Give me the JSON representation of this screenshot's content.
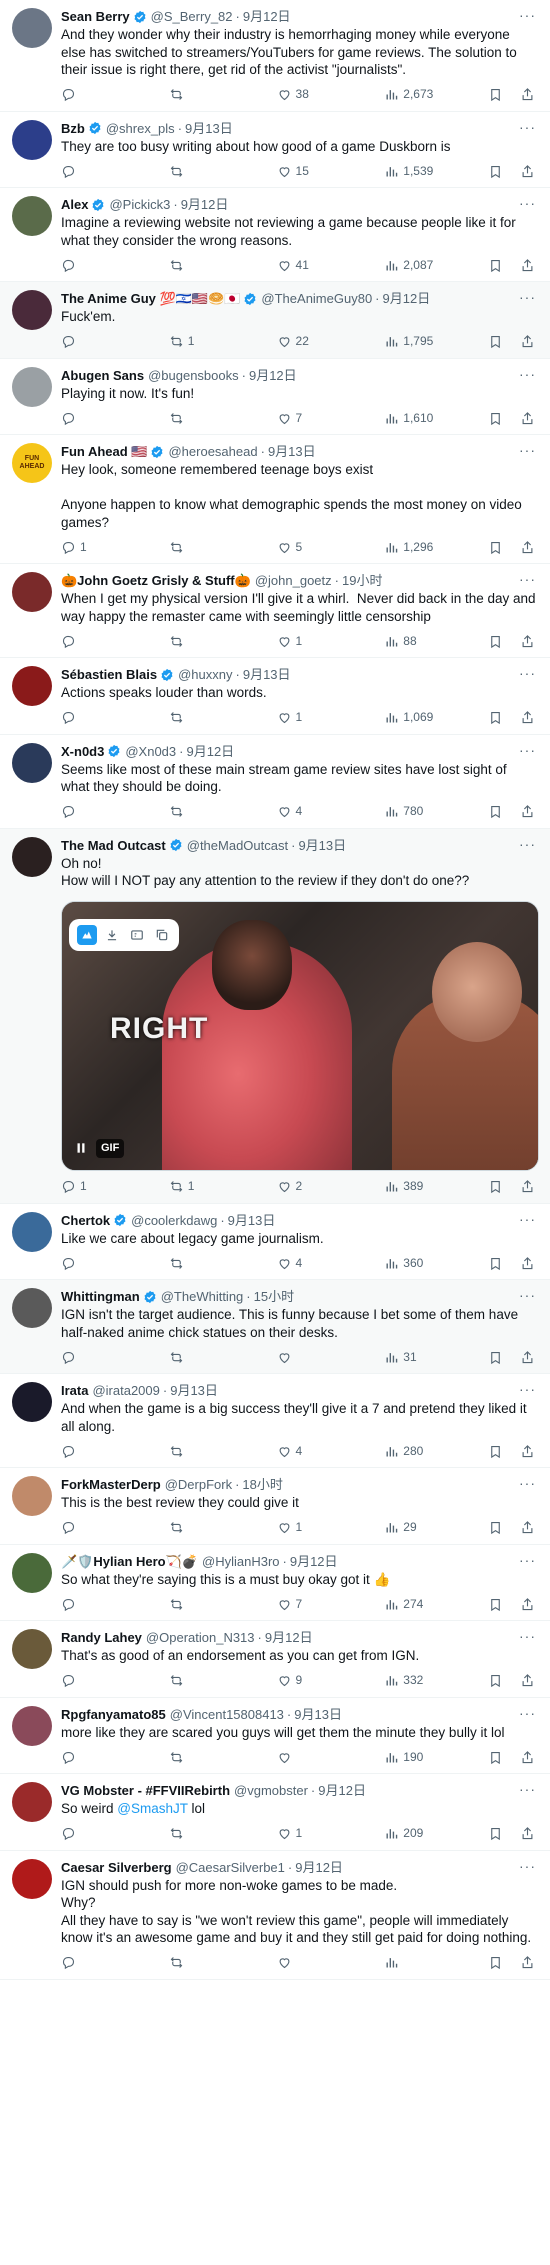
{
  "feed": {
    "tweets": [
      {
        "name": "Sean Berry",
        "badges": [
          "verified"
        ],
        "handle": "@S_Berry_82",
        "time": "9月12日",
        "text": "And they wonder why their industry is hemorrhaging money while everyone else has switched to streamers/YouTubers for game reviews. The solution to their issue is right there, get rid of the activist \"journalists\".",
        "replies": "",
        "reposts": "",
        "likes": "38",
        "views": "2,673",
        "avatar_color": "#6b7686"
      },
      {
        "name": "Bzb",
        "badges": [
          "verified"
        ],
        "handle": "@shrex_pls",
        "time": "9月13日",
        "text": "They are too busy writing about how good of a game Duskborn is",
        "replies": "",
        "reposts": "",
        "likes": "15",
        "views": "1,539",
        "avatar_color": "#2c3e8a"
      },
      {
        "name": "Alex",
        "badges": [
          "verified"
        ],
        "handle": "@Pickick3",
        "time": "9月12日",
        "text": "Imagine a reviewing website not reviewing a game because people like it for what they consider the wrong reasons.",
        "replies": "",
        "reposts": "",
        "likes": "41",
        "views": "2,087",
        "avatar_color": "#5a6b4a"
      },
      {
        "name": "The Anime Guy 💯🇮🇱🇺🇸🥯🇯🇵",
        "badges": [
          "verified"
        ],
        "handle": "@TheAnimeGuy80",
        "time": "9月12日",
        "text": "Fuck'em.",
        "replies": "",
        "reposts": "1",
        "likes": "22",
        "views": "1,795",
        "avatar_color": "#4a2a3a",
        "highlight": true
      },
      {
        "name": "Abugen Sans",
        "badges": [],
        "handle": "@bugensbooks",
        "time": "9月12日",
        "text": "Playing it now. It's fun!",
        "replies": "",
        "reposts": "",
        "likes": "7",
        "views": "1,610",
        "avatar_color": "#9aa0a4"
      },
      {
        "name": "Fun Ahead 🇺🇸",
        "badges": [
          "verified"
        ],
        "handle": "@heroesahead",
        "time": "9月13日",
        "text": "Hey look, someone remembered teenage boys exist\n\nAnyone happen to know what demographic spends the most money on video games?",
        "replies": "1",
        "reposts": "",
        "likes": "5",
        "views": "1,296",
        "avatar_color": "#f5c518",
        "avatar_label": "FUN AHEAD"
      },
      {
        "name": "🎃John Goetz Grisly & Stuff🎃",
        "badges": [],
        "handle": "@john_goetz",
        "time": "19小时",
        "text": "When I get my physical version I'll give it a whirl.  Never did back in the day and way happy the remaster came with seemingly little censorship",
        "replies": "",
        "reposts": "",
        "likes": "1",
        "views": "88",
        "avatar_color": "#7a2a2a"
      },
      {
        "name": "Sébastien Blais",
        "badges": [
          "verified"
        ],
        "handle": "@huxxny",
        "time": "9月13日",
        "text": "Actions speaks louder than words.",
        "replies": "",
        "reposts": "",
        "likes": "1",
        "views": "1,069",
        "avatar_color": "#8a1a1a"
      },
      {
        "name": "X-n0d3",
        "badges": [
          "verified"
        ],
        "handle": "@Xn0d3",
        "time": "9月12日",
        "text": "Seems like most of these main stream game review sites have lost sight of what they should be doing.",
        "replies": "",
        "reposts": "",
        "likes": "4",
        "views": "780",
        "avatar_color": "#2a3a5a"
      },
      {
        "name": "The Mad Outcast",
        "badges": [
          "verified"
        ],
        "handle": "@theMadOutcast",
        "time": "9月13日",
        "text": "Oh no!\nHow will I NOT pay any attention to the review if they don't do one??",
        "replies": "1",
        "reposts": "1",
        "likes": "2",
        "views": "389",
        "avatar_color": "#2a2020",
        "highlight": true,
        "media": {
          "overlay_text": "RIGHT",
          "badge": "GIF",
          "icons": [
            "bird-icon",
            "download-icon",
            "gif-icon",
            "copy-icon"
          ]
        }
      },
      {
        "name": "Chertok",
        "badges": [
          "verified"
        ],
        "handle": "@coolerkdawg",
        "time": "9月13日",
        "text": "Like we care about legacy game journalism.",
        "replies": "",
        "reposts": "",
        "likes": "4",
        "views": "360",
        "avatar_color": "#3a6a9a"
      },
      {
        "name": "Whittingman",
        "badges": [
          "verified"
        ],
        "handle": "@TheWhitting",
        "time": "15小时",
        "text": "IGN isn't the target audience. This is funny because I bet some of them have half-naked anime chick statues on their desks.",
        "replies": "",
        "reposts": "",
        "likes": "",
        "views": "31",
        "avatar_color": "#5a5a5a",
        "highlight": true
      },
      {
        "name": "Irata",
        "badges": [],
        "handle": "@irata2009",
        "time": "9月13日",
        "text": "And when the game is a big success they'll give it a 7 and pretend they liked it all along.",
        "replies": "",
        "reposts": "",
        "likes": "4",
        "views": "280",
        "avatar_color": "#1a1a2a"
      },
      {
        "name": "ForkMasterDerp",
        "badges": [],
        "handle": "@DerpFork",
        "time": "18小时",
        "text": "This is the best review they could give it",
        "replies": "",
        "reposts": "",
        "likes": "1",
        "views": "29",
        "avatar_color": "#c08a6a"
      },
      {
        "name": "🗡️🛡️Hylian Hero🏹💣",
        "badges": [],
        "handle": "@HylianH3ro",
        "time": "9月12日",
        "text": "So what they're saying this is a must buy okay got it 👍",
        "replies": "",
        "reposts": "",
        "likes": "7",
        "views": "274",
        "avatar_color": "#4a6a3a"
      },
      {
        "name": "Randy Lahey",
        "badges": [],
        "handle": "@Operation_N313",
        "time": "9月12日",
        "text": "That's as good of an endorsement as you can get from IGN.",
        "replies": "",
        "reposts": "",
        "likes": "9",
        "views": "332",
        "avatar_color": "#6a5a3a"
      },
      {
        "name": "Rpgfanyamato85",
        "badges": [],
        "handle": "@Vincent15808413",
        "time": "9月13日",
        "text": "more like they are scared you guys will get them the minute they bully it lol",
        "replies": "",
        "reposts": "",
        "likes": "",
        "views": "190",
        "avatar_color": "#8a4a5a"
      },
      {
        "name": "VG Mobster - #FFVIIRebirth",
        "badges": [],
        "handle": "@vgmobster",
        "time": "9月12日",
        "text_parts": [
          "So weird ",
          "@SmashJT",
          " lol"
        ],
        "replies": "",
        "reposts": "",
        "likes": "1",
        "views": "209",
        "avatar_color": "#9a2a2a"
      },
      {
        "name": "Caesar Silverberg",
        "badges": [],
        "handle": "@CaesarSilverbe1",
        "time": "9月12日",
        "text": "IGN should push for more non-woke games to be made.\nWhy?\nAll they have to say is \"we won't review this game\", people will immediately know it's an awesome game and buy it and they still get paid for doing nothing.",
        "replies": "",
        "reposts": "",
        "likes": "",
        "views": "",
        "avatar_color": "#b01a1a"
      }
    ]
  },
  "colors": {
    "accent": "#1d9bf0",
    "muted": "#536471",
    "text": "#0f1419",
    "border": "#eff3f4"
  }
}
